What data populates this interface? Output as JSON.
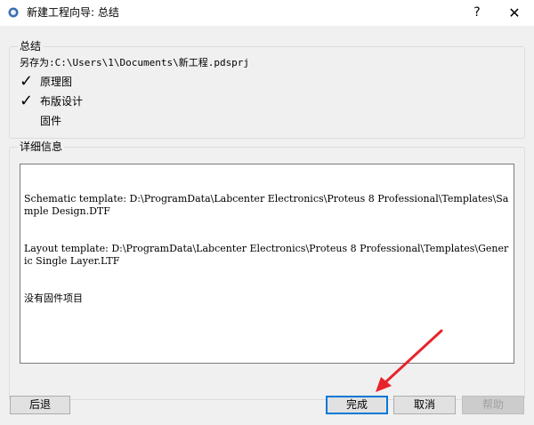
{
  "window": {
    "title": "新建工程向导: 总结",
    "help_label": "?",
    "close_label": "✕"
  },
  "summary": {
    "group_title": "总结",
    "save_path": "另存为:C:\\Users\\1\\Documents\\新工程.pdsprj",
    "items": [
      {
        "label": "原理图",
        "checked": true,
        "check_mark": "✓"
      },
      {
        "label": "布版设计",
        "checked": true,
        "check_mark": "✓"
      },
      {
        "label": "固件",
        "checked": false,
        "check_mark": ""
      }
    ]
  },
  "details": {
    "group_title": "详细信息",
    "lines": [
      "Schematic template: D:\\ProgramData\\Labcenter Electronics\\Proteus 8 Professional\\Templates\\Sample Design.DTF",
      "Layout template: D:\\ProgramData\\Labcenter Electronics\\Proteus 8 Professional\\Templates\\Generic Single Layer.LTF",
      "没有固件项目"
    ]
  },
  "buttons": {
    "back": "后退",
    "finish": "完成",
    "cancel": "取消",
    "help": "帮助"
  },
  "colors": {
    "annotation_arrow": "#e8242b",
    "focus_border": "#0078d7"
  }
}
